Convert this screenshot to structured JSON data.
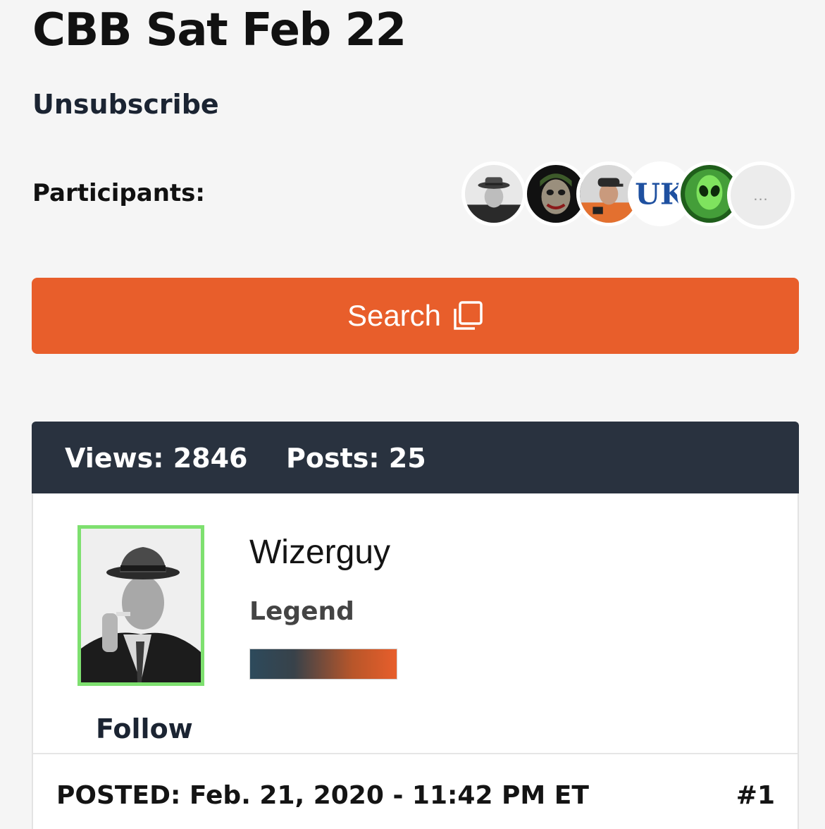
{
  "thread": {
    "title": "CBB Sat Feb 22",
    "unsubscribe_label": "Unsubscribe",
    "participants_label": "Participants:",
    "participants_more": "...",
    "search_label": "Search"
  },
  "stats": {
    "views": "Views: 2846",
    "posts": "Posts: 25"
  },
  "post": {
    "username": "Wizerguy",
    "rank": "Legend",
    "follow_label": "Follow",
    "posted": "POSTED: Feb. 21, 2020 - 11:42 PM ET",
    "number": "#1"
  },
  "icons": {
    "search_button_icon": "external-link-icon"
  },
  "colors": {
    "accent": "#e85e2b",
    "header_bg": "#29323f",
    "avatar_border_highlight": "#7ee06f"
  }
}
